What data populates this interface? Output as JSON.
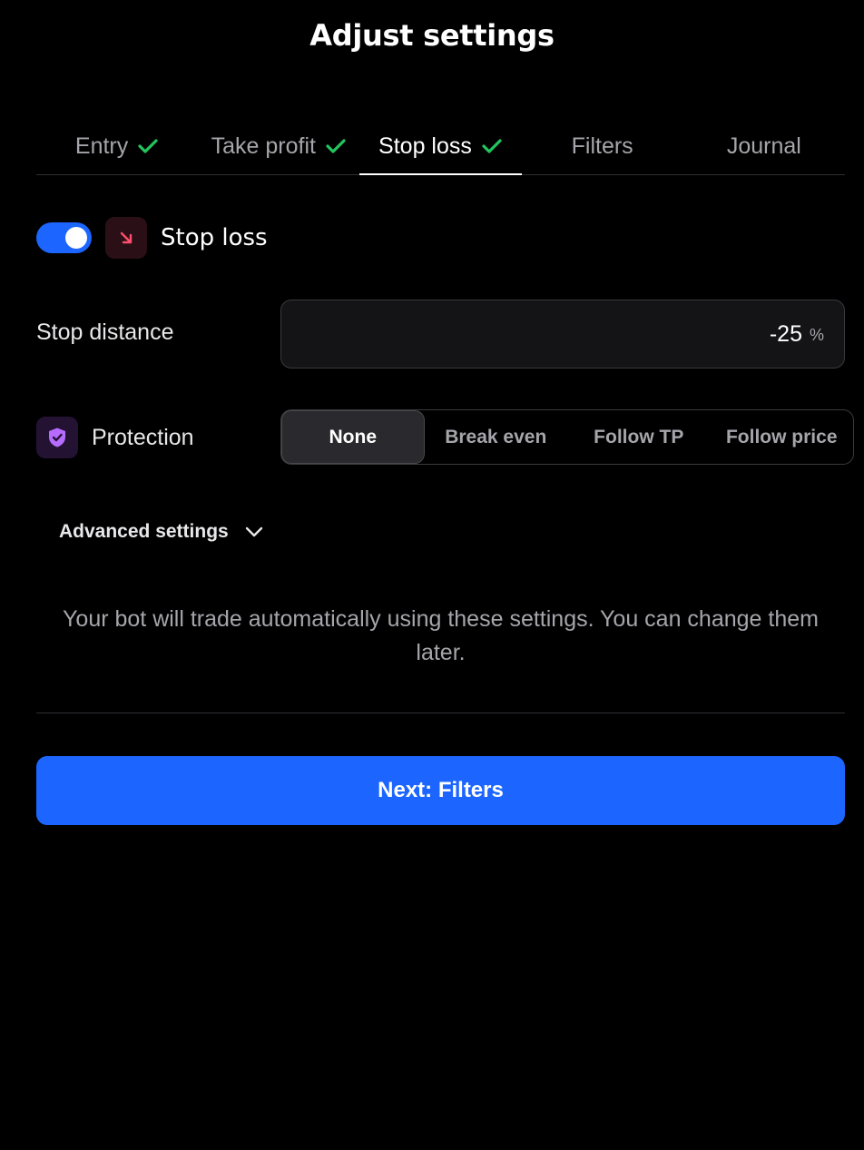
{
  "page": {
    "title": "Adjust settings"
  },
  "tabs": [
    {
      "label": "Entry",
      "completed": true
    },
    {
      "label": "Take profit",
      "completed": true
    },
    {
      "label": "Stop loss",
      "completed": true,
      "active": true
    },
    {
      "label": "Filters",
      "completed": false
    },
    {
      "label": "Journal",
      "completed": false
    }
  ],
  "stop_loss": {
    "enabled": true,
    "label": "Stop loss",
    "icon": "arrow-down-right-icon"
  },
  "stop_distance": {
    "label": "Stop distance",
    "value": "-25",
    "unit": "%"
  },
  "protection": {
    "label": "Protection",
    "icon": "shield-check-icon",
    "options": [
      "None",
      "Break even",
      "Follow TP",
      "Follow price"
    ],
    "selected": "None"
  },
  "advanced": {
    "label": "Advanced settings"
  },
  "note": "Your bot will trade automatically using these settings. You can change them later.",
  "next_button": {
    "label": "Next: Filters"
  },
  "colors": {
    "accent": "#1c66ff",
    "check": "#22c55e",
    "stop_loss_icon": "#ff4d6d",
    "protection_icon": "#b56cff"
  }
}
